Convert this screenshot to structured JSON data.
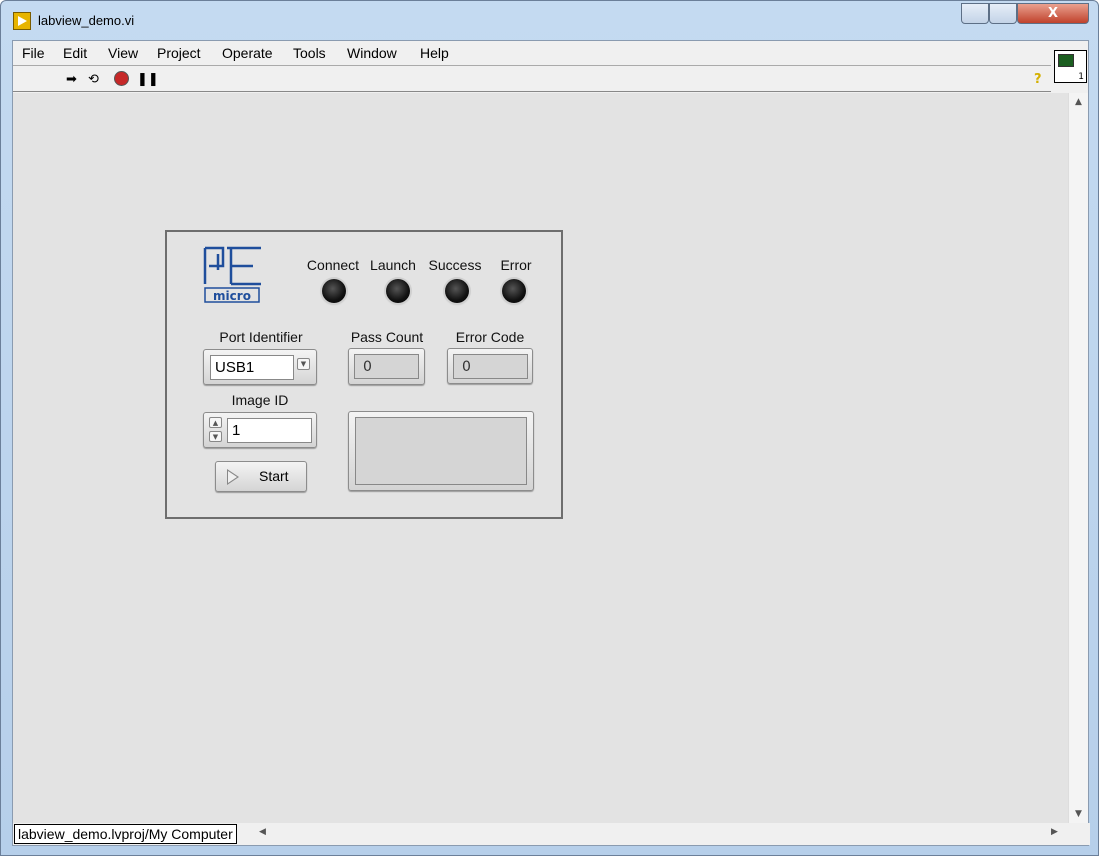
{
  "window": {
    "title": "labview_demo.vi",
    "close_label": "X"
  },
  "menu": [
    "File",
    "Edit",
    "View",
    "Project",
    "Operate",
    "Tools",
    "Window",
    "Help"
  ],
  "toolbar": {
    "icons": [
      "run-arrow-icon",
      "run-continuously-icon",
      "abort-icon",
      "pause-icon"
    ],
    "help": "?"
  },
  "vi_icon": {
    "label": "1"
  },
  "panel": {
    "logo": "PE micro",
    "leds": [
      {
        "label": "Connect",
        "on": false
      },
      {
        "label": "Launch",
        "on": false
      },
      {
        "label": "Success",
        "on": false
      },
      {
        "label": "Error",
        "on": false
      }
    ],
    "port_identifier": {
      "label": "Port Identifier",
      "value": "USB1"
    },
    "pass_count": {
      "label": "Pass Count",
      "value": "0"
    },
    "error_code": {
      "label": "Error Code",
      "value": "0"
    },
    "image_id": {
      "label": "Image ID",
      "value": "1"
    },
    "start_button": {
      "label": "Start"
    },
    "message": {
      "value": ""
    }
  },
  "status": {
    "context": "labview_demo.lvproj/My Computer"
  },
  "colors": {
    "canvas": "#e3e3e3",
    "logo": "#1f4e9c",
    "titlebar": "#c4daf1"
  }
}
